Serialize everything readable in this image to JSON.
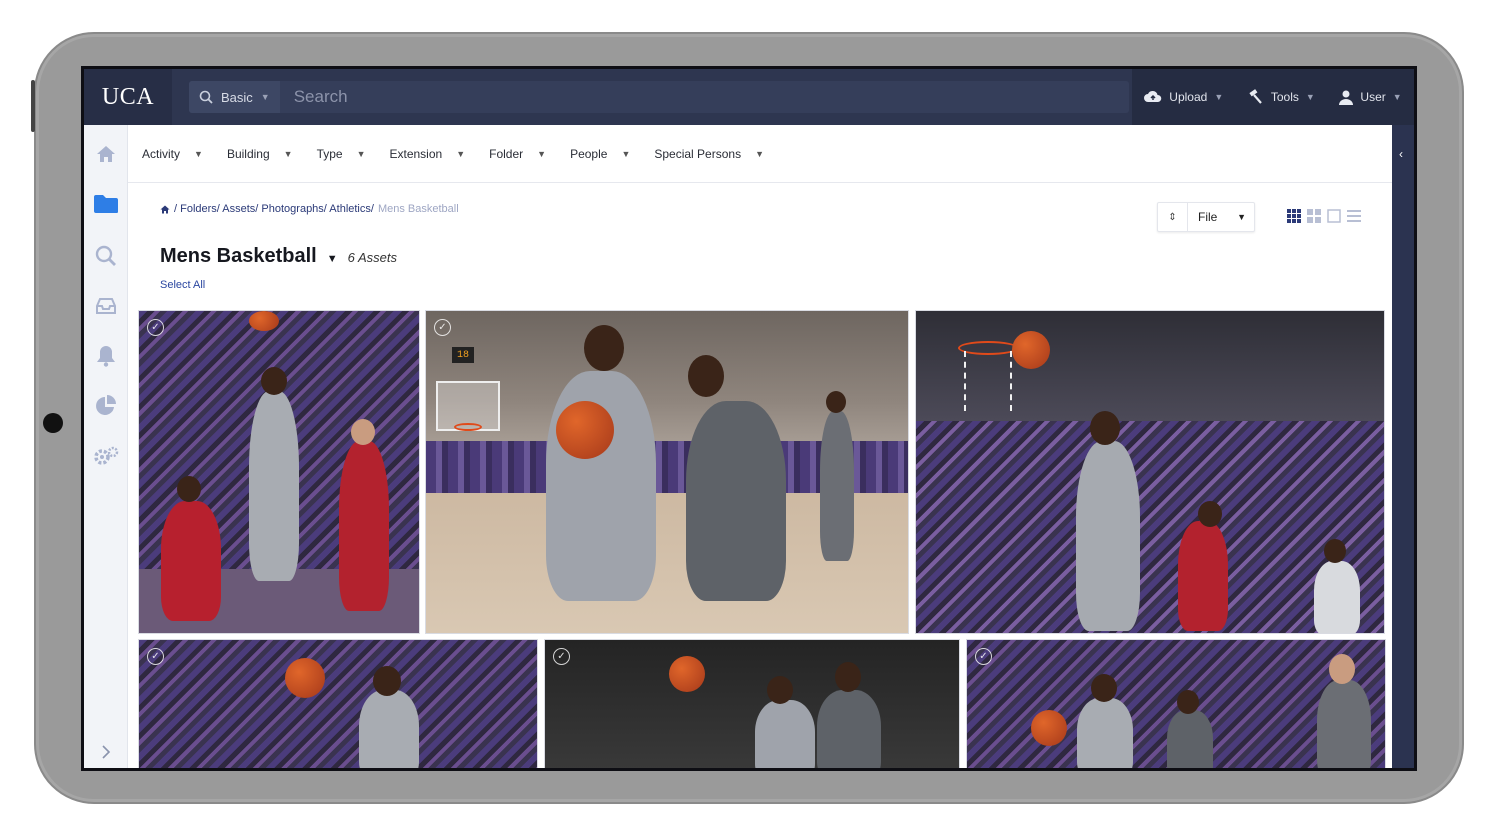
{
  "header": {
    "logo": "UCA",
    "search_mode": "Basic",
    "search_placeholder": "Search",
    "upload_label": "Upload",
    "tools_label": "Tools",
    "user_label": "User"
  },
  "filters": [
    {
      "label": "Activity"
    },
    {
      "label": "Building"
    },
    {
      "label": "Type"
    },
    {
      "label": "Extension"
    },
    {
      "label": "Folder"
    },
    {
      "label": "People"
    },
    {
      "label": "Special Persons"
    }
  ],
  "breadcrumb": {
    "path": "/ Folders/ Assets/ Photographs/ Athletics/",
    "current": "Mens Basketball"
  },
  "content": {
    "title": "Mens Basketball",
    "asset_count": "6 Assets",
    "select_all": "Select All",
    "sort_by": "File"
  },
  "colors": {
    "topbar": "#2e3650",
    "accent": "#2a46a0",
    "jersey_home": "#9aa0a6",
    "jersey_away": "#b0202c",
    "crowd_purple": "#4a3a78"
  }
}
